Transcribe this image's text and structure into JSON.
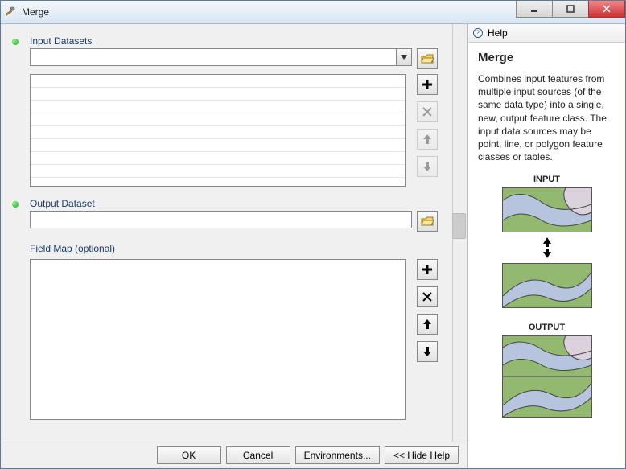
{
  "window": {
    "title": "Merge"
  },
  "form": {
    "input_datasets": {
      "label": "Input Datasets",
      "value": ""
    },
    "output_dataset": {
      "label": "Output Dataset",
      "value": ""
    },
    "field_map": {
      "label": "Field Map (optional)"
    }
  },
  "buttons": {
    "ok": "OK",
    "cancel": "Cancel",
    "environments": "Environments...",
    "hide_help": "<< Hide Help"
  },
  "help": {
    "panel_label": "Help",
    "title": "Merge",
    "description": "Combines input features from multiple input sources (of the same data type) into a single, new, output feature class. The input data sources may be point, line, or polygon feature classes or tables.",
    "fig_input": "INPUT",
    "fig_output": "OUTPUT"
  },
  "icons": {
    "hammer": "hammer-icon",
    "browse": "folder-open",
    "add": "+",
    "remove": "✕",
    "up": "↑",
    "down": "↓"
  }
}
